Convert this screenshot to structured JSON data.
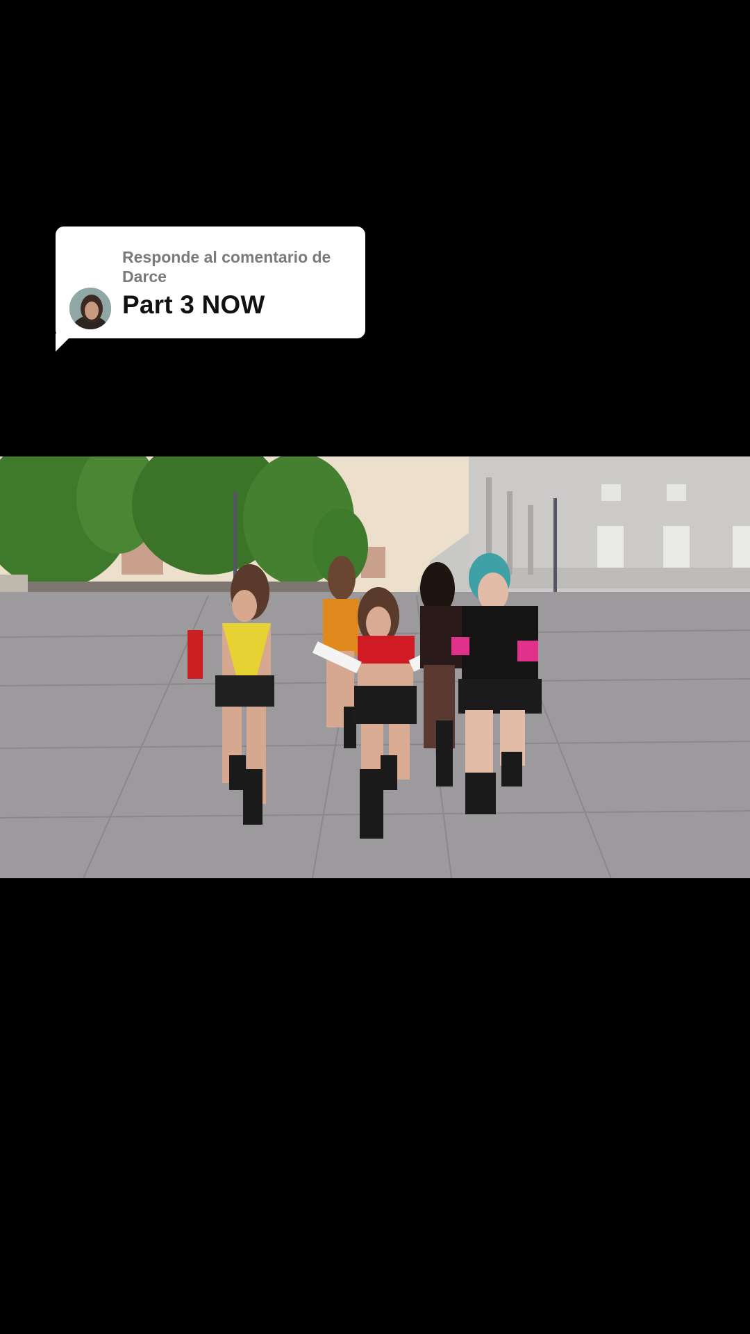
{
  "reply_bubble": {
    "label": "Responde al comentario de Darce",
    "text": "Part 3 NOW",
    "avatar_icon": "user-avatar"
  },
  "video": {
    "scene": "dance-video-frame",
    "colors": {
      "sky": "#ece0cd",
      "pavement": "#9c9a9c",
      "trees": "#3f7a2c",
      "building": "#c8c8c6"
    }
  }
}
